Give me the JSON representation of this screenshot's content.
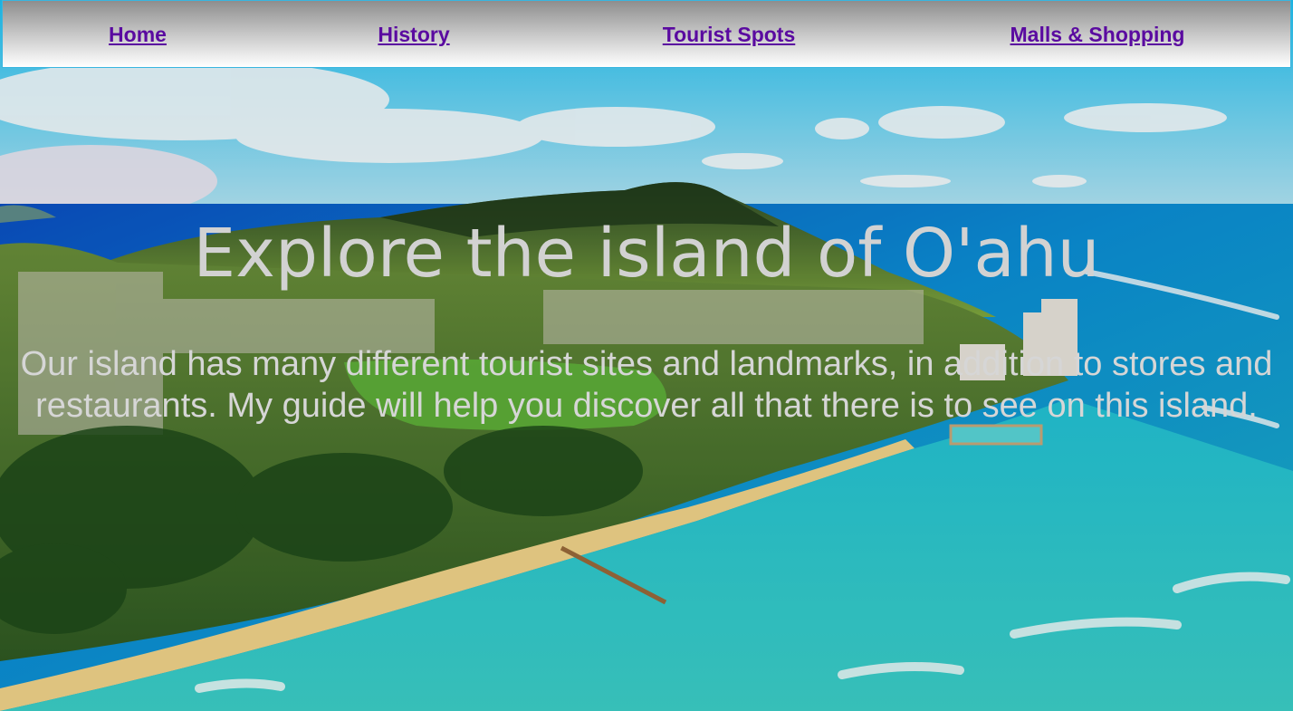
{
  "nav": {
    "items": [
      {
        "label": "Home"
      },
      {
        "label": "History"
      },
      {
        "label": "Tourist Spots"
      },
      {
        "label": "Malls & Shopping"
      }
    ]
  },
  "hero": {
    "title": "Explore the island of O'ahu",
    "text": "Our island has many different tourist sites and landmarks, in addition to stores and restaurants. My guide will help you discover all that there is to see on this island."
  },
  "colors": {
    "nav_link": "#5a0aa0",
    "nav_border": "#38b6e0",
    "hero_text": "#d2d2d2"
  }
}
